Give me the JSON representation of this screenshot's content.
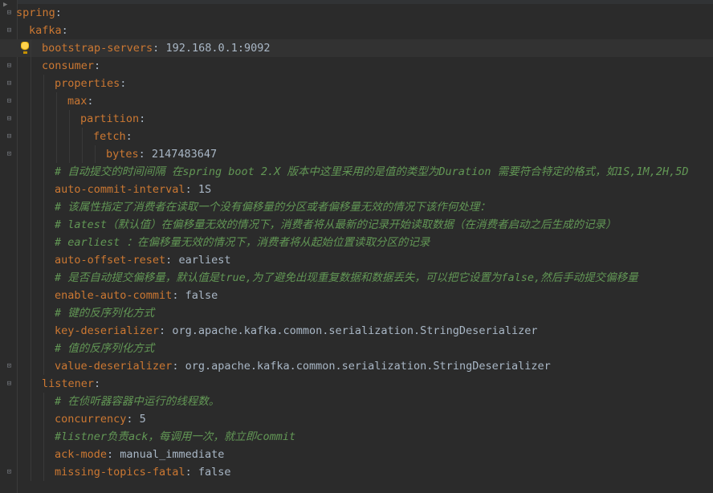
{
  "editor": {
    "lines": [
      {
        "indent": 0,
        "type": "key",
        "key": "spring",
        "fold": "open"
      },
      {
        "indent": 1,
        "type": "key",
        "key": "kafka",
        "fold": "open"
      },
      {
        "indent": 2,
        "type": "pair",
        "key": "bootstrap-servers",
        "value": "192.168.0.1:9092",
        "current": true,
        "bulb": true
      },
      {
        "indent": 2,
        "type": "key",
        "key": "consumer",
        "fold": "open"
      },
      {
        "indent": 3,
        "type": "key",
        "key": "properties",
        "fold": "open"
      },
      {
        "indent": 4,
        "type": "key",
        "key": "max",
        "fold": "open"
      },
      {
        "indent": 5,
        "type": "key",
        "key": "partition",
        "fold": "open"
      },
      {
        "indent": 6,
        "type": "key",
        "key": "fetch",
        "fold": "open"
      },
      {
        "indent": 7,
        "type": "pair",
        "key": "bytes",
        "value": "2147483647",
        "fold": "close"
      },
      {
        "indent": 3,
        "type": "comment",
        "text": "# 自动提交的时间间隔 在spring boot 2.X 版本中这里采用的是值的类型为Duration 需要符合特定的格式，如1S,1M,2H,5D"
      },
      {
        "indent": 3,
        "type": "pair",
        "key": "auto-commit-interval",
        "value": "1S"
      },
      {
        "indent": 3,
        "type": "comment",
        "text": "# 该属性指定了消费者在读取一个没有偏移量的分区或者偏移量无效的情况下该作何处理："
      },
      {
        "indent": 3,
        "type": "comment",
        "text": "# latest（默认值）在偏移量无效的情况下，消费者将从最新的记录开始读取数据（在消费者启动之后生成的记录）"
      },
      {
        "indent": 3,
        "type": "comment",
        "text": "# earliest ：在偏移量无效的情况下，消费者将从起始位置读取分区的记录"
      },
      {
        "indent": 3,
        "type": "pair",
        "key": "auto-offset-reset",
        "value": "earliest"
      },
      {
        "indent": 3,
        "type": "comment",
        "text": "# 是否自动提交偏移量，默认值是true,为了避免出现重复数据和数据丢失，可以把它设置为false,然后手动提交偏移量"
      },
      {
        "indent": 3,
        "type": "pair",
        "key": "enable-auto-commit",
        "value": "false"
      },
      {
        "indent": 3,
        "type": "comment",
        "text": "# 键的反序列化方式"
      },
      {
        "indent": 3,
        "type": "pair",
        "key": "key-deserializer",
        "value": "org.apache.kafka.common.serialization.StringDeserializer"
      },
      {
        "indent": 3,
        "type": "comment",
        "text": "# 值的反序列化方式"
      },
      {
        "indent": 3,
        "type": "pair",
        "key": "value-deserializer",
        "value": "org.apache.kafka.common.serialization.StringDeserializer",
        "fold": "close"
      },
      {
        "indent": 2,
        "type": "key",
        "key": "listener",
        "fold": "open"
      },
      {
        "indent": 3,
        "type": "comment",
        "text": "# 在侦听器容器中运行的线程数。"
      },
      {
        "indent": 3,
        "type": "pair",
        "key": "concurrency",
        "value": "5"
      },
      {
        "indent": 3,
        "type": "comment",
        "text": "#listner负责ack，每调用一次，就立即commit"
      },
      {
        "indent": 3,
        "type": "pair",
        "key": "ack-mode",
        "value": "manual_immediate"
      },
      {
        "indent": 3,
        "type": "pair",
        "key": "missing-topics-fatal",
        "value": "false",
        "fold": "close"
      }
    ]
  },
  "colors": {
    "background": "#2b2b2b",
    "key": "#cc7832",
    "value": "#a9b7c6",
    "comment": "#629755",
    "current_line": "#323232"
  },
  "icons": {
    "fold_open": "fold-open-icon",
    "fold_close": "fold-close-icon",
    "intention": "lightbulb-icon"
  }
}
